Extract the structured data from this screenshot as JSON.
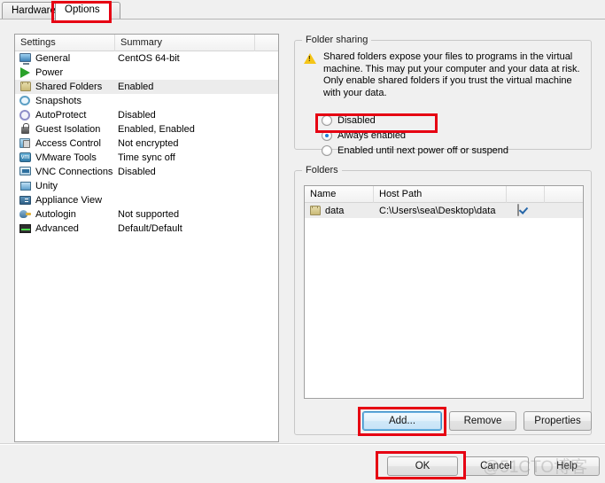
{
  "window": {
    "tabs": [
      {
        "label": "Hardware",
        "selected": false
      },
      {
        "label": "Options",
        "selected": true
      }
    ]
  },
  "settings_list": {
    "columns": [
      "Settings",
      "Summary",
      ""
    ],
    "rows": [
      {
        "icon": "monitor-icon",
        "label": "General",
        "summary": "CentOS 64-bit",
        "selected": false
      },
      {
        "icon": "play-icon",
        "label": "Power",
        "summary": "",
        "selected": false
      },
      {
        "icon": "folder-icon",
        "label": "Shared Folders",
        "summary": "Enabled",
        "selected": true
      },
      {
        "icon": "camera-icon",
        "label": "Snapshots",
        "summary": "",
        "selected": false
      },
      {
        "icon": "autoprotect-icon",
        "label": "AutoProtect",
        "summary": "Disabled",
        "selected": false
      },
      {
        "icon": "lock-icon",
        "label": "Guest Isolation",
        "summary": "Enabled, Enabled",
        "selected": false
      },
      {
        "icon": "access-control-icon",
        "label": "Access Control",
        "summary": "Not encrypted",
        "selected": false
      },
      {
        "icon": "vmware-tools-icon",
        "label": "VMware Tools",
        "summary": "Time sync off",
        "selected": false
      },
      {
        "icon": "vnc-icon",
        "label": "VNC Connections",
        "summary": "Disabled",
        "selected": false
      },
      {
        "icon": "unity-icon",
        "label": "Unity",
        "summary": "",
        "selected": false
      },
      {
        "icon": "appliance-icon",
        "label": "Appliance View",
        "summary": "",
        "selected": false
      },
      {
        "icon": "autologin-icon",
        "label": "Autologin",
        "summary": "Not supported",
        "selected": false
      },
      {
        "icon": "advanced-icon",
        "label": "Advanced",
        "summary": "Default/Default",
        "selected": false
      }
    ]
  },
  "folder_sharing": {
    "title": "Folder sharing",
    "warning": "Shared folders expose your files to programs in the virtual machine. This may put your computer and your data at risk. Only enable shared folders if you trust the virtual machine with your data.",
    "options": [
      {
        "label": "Disabled",
        "checked": false
      },
      {
        "label": "Always enabled",
        "checked": true
      },
      {
        "label": "Enabled until next power off or suspend",
        "checked": false
      }
    ]
  },
  "folders": {
    "title": "Folders",
    "columns": [
      "Name",
      "Host Path",
      "",
      ""
    ],
    "rows": [
      {
        "icon": "folder-icon",
        "name": "data",
        "host_path": "C:\\Users\\sea\\Desktop\\data",
        "enabled": true
      }
    ],
    "buttons": {
      "add": "Add...",
      "remove": "Remove",
      "properties": "Properties"
    }
  },
  "dialog_buttons": {
    "ok": "OK",
    "cancel": "Cancel",
    "help": "Help"
  },
  "watermark": "@51CTO博客",
  "colors": {
    "annotation": "#e60012",
    "accent": "#1f7fd4",
    "warning": "#f5c518",
    "selection": "#ececec"
  }
}
